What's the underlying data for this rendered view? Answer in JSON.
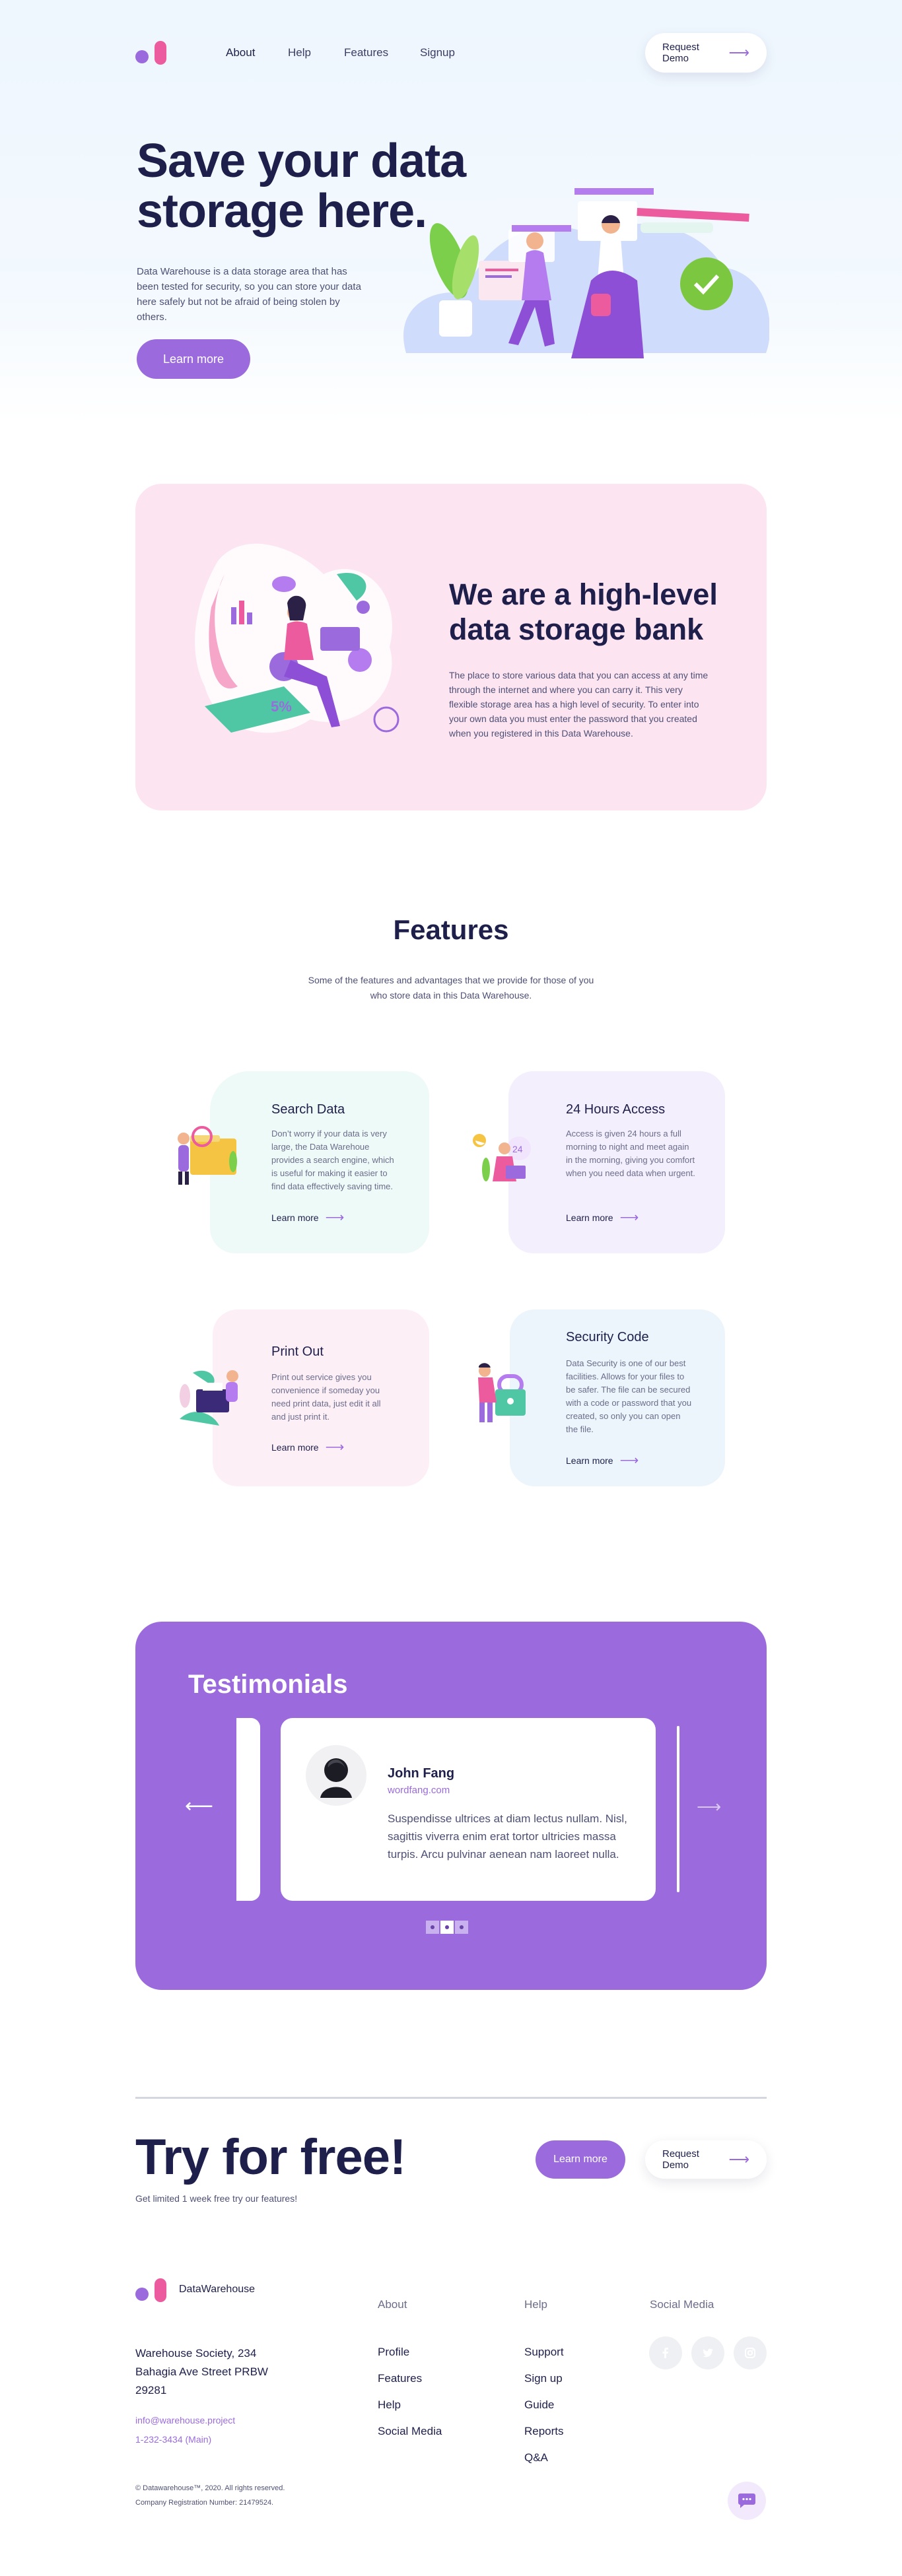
{
  "nav": {
    "links": [
      "About",
      "Help",
      "Features",
      "Signup"
    ],
    "demo_label": "Request Demo"
  },
  "hero": {
    "title_line1": "Save your data",
    "title_line2": "storage here.",
    "description": "Data Warehouse is a data storage area that has been tested for security, so you can store your data here safely but not be afraid of being stolen by others.",
    "cta_label": "Learn more"
  },
  "bank": {
    "title_line1": "We are a high-level",
    "title_line2": "data storage bank",
    "description": "The place to store various data that you can access at any time through the internet and where you can carry it. This very flexible storage area has a high level of security. To enter into your own data you must enter the password that you created when you registered in this Data Warehouse."
  },
  "features": {
    "title": "Features",
    "subtitle": "Some of the features and advantages that we provide for those of you who store data in this Data Warehouse.",
    "cards": [
      {
        "title": "Search Data",
        "text": "Don’t worry if your data is very large, the Data Warehoue provides a search engine, which is useful for making it easier to find data effectively saving time.",
        "link": "Learn more",
        "color": "#eefaf7"
      },
      {
        "title": "24 Hours Access",
        "text": "Access is given 24 hours a full morning to night and meet again in the morning, giving you comfort when you need data when urgent.",
        "link": "Learn more",
        "color": "#f3effd"
      },
      {
        "title": "Print Out",
        "text": "Print out service gives you convenience if someday you need print data, just edit it all and just print it.",
        "link": "Learn more",
        "color": "#fdeff6"
      },
      {
        "title": "Security Code",
        "text": "Data Security is one of our best facilities. Allows for your files to be safer. The file can be secured with a code or password that you created, so only you can open the file.",
        "link": "Learn more",
        "color": "#ebf5fb"
      }
    ]
  },
  "testimonials": {
    "title": "Testimonials",
    "name": "John Fang",
    "site": "wordfang.com",
    "quote": "Suspendisse ultrices at diam lectus nullam. Nisl, sagittis viverra enim erat tortor ultricies massa turpis. Arcu pulvinar aenean nam laoreet nulla.",
    "slide_count": 3,
    "active_slide": 2
  },
  "cta": {
    "title": "Try for free!",
    "subtitle": "Get limited 1 week free try our features!",
    "learn_label": "Learn more",
    "demo_label": "Request Demo"
  },
  "footer": {
    "brand": "DataWarehouse",
    "address_line1": "Warehouse Society, 234",
    "address_line2": "Bahagia Ave Street PRBW",
    "address_line3": "29281",
    "email": "info@warehouse.project",
    "phone": "1-232-3434 (Main)",
    "col_about": {
      "heading": "About",
      "links": [
        "Profile",
        "Features",
        "Help",
        "Social Media"
      ]
    },
    "col_help": {
      "heading": "Help",
      "links": [
        "Support",
        "Sign up",
        "Guide",
        "Reports",
        "Q&A"
      ]
    },
    "col_social": {
      "heading": "Social Media"
    },
    "copyright": "© Datawarehouse™, 2020. All rights reserved.",
    "registration": "Company Registration Number: 21479524."
  },
  "colors": {
    "accent": "#9b6bde",
    "navy": "#1e1f4b",
    "pink": "#ec5b9d"
  }
}
